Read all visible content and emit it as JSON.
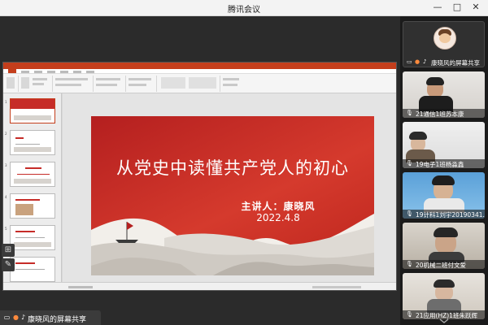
{
  "window": {
    "title": "腾讯会议"
  },
  "window_controls": {
    "minimize": "—",
    "maximize": "□",
    "close": "✕"
  },
  "presentation": {
    "slide": {
      "heading": "从党史中读懂共产党人的初心",
      "presenter": "主讲人：康晓风",
      "date": "2022.4.8"
    }
  },
  "share_status": {
    "label": "康晓风的屏幕共享"
  },
  "participants": [
    {
      "name": "康晓风的屏幕共享",
      "icon": "avatar-icon"
    },
    {
      "name": "21通信1班苏本康",
      "icon": "mic-muted-icon"
    },
    {
      "name": "19电子1班杨淼鑫",
      "icon": "mic-muted-icon"
    },
    {
      "name": "19计科1刘宇20190341...",
      "icon": "mic-muted-icon"
    },
    {
      "name": "20机械二班付文爱",
      "icon": "mic-muted-icon"
    },
    {
      "name": "21应用(HZ)1班朱跃辉",
      "icon": "mic-muted-icon"
    }
  ],
  "colors": {
    "accent_red": "#c62c28",
    "panel_bg": "#1b1b1b",
    "share_bg": "#2b2b2b"
  }
}
